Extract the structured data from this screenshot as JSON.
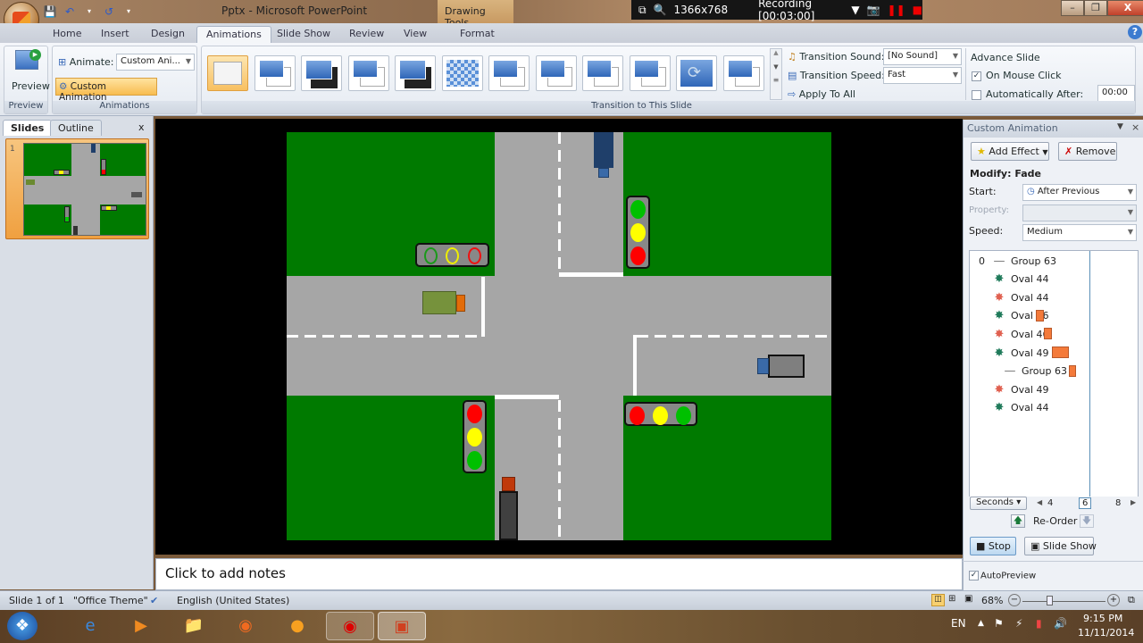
{
  "window": {
    "title": "Pptx - Microsoft PowerPoint",
    "contextual_tab_group": "Drawing Tools",
    "controls": [
      "minimize",
      "restore",
      "close"
    ]
  },
  "recorder": {
    "resolution": "1366x768",
    "status": "Recording [00:03:00]"
  },
  "ribbon_tabs": [
    "Home",
    "Insert",
    "Design",
    "Animations",
    "Slide Show",
    "Review",
    "View",
    "Format"
  ],
  "active_tab": "Animations",
  "ribbon": {
    "preview": {
      "button_label": "Preview",
      "group_label": "Preview"
    },
    "animations": {
      "animate_label": "Animate:",
      "animate_value": "Custom Ani...",
      "custom_animation_label": "Custom Animation",
      "group_label": "Animations"
    },
    "transition": {
      "group_label": "Transition to This Slide",
      "effects": [
        "No Transition",
        "Fade Smoothly",
        "Fade Through Black",
        "Cut",
        "Cut Through Black",
        "Dissolve",
        "Wipe Down",
        "Wipe Left",
        "Wipe Right",
        "Wipe Up",
        "Wheel",
        "Cover Down"
      ],
      "sound_label": "Transition Sound:",
      "sound_value": "[No Sound]",
      "speed_label": "Transition Speed:",
      "speed_value": "Fast",
      "apply_all_label": "Apply To All"
    },
    "advance": {
      "title": "Advance Slide",
      "on_mouse_click_label": "On Mouse Click",
      "on_mouse_click_checked": true,
      "auto_after_label": "Automatically After:",
      "auto_after_checked": false,
      "auto_after_value": "00:00"
    }
  },
  "slides_panel": {
    "tabs": [
      "Slides",
      "Outline"
    ],
    "close": "x",
    "slide_number": "1"
  },
  "notes": {
    "placeholder": "Click to add notes"
  },
  "task_pane": {
    "title": "Custom Animation",
    "add_effect_label": "Add Effect",
    "remove_label": "Remove",
    "modify_label": "Modify: Fade",
    "start_label": "Start:",
    "start_value": "After Previous",
    "property_label": "Property:",
    "property_value": "",
    "speed_label": "Speed:",
    "speed_value": "Medium",
    "items": [
      {
        "index": "0",
        "kind": "group",
        "name": "Group 63"
      },
      {
        "index": "",
        "kind": "entrance",
        "name": "Oval 44"
      },
      {
        "index": "",
        "kind": "exit",
        "name": "Oval 44"
      },
      {
        "index": "",
        "kind": "entrance",
        "name": "Oval 46"
      },
      {
        "index": "",
        "kind": "exit",
        "name": "Oval 46"
      },
      {
        "index": "",
        "kind": "entrance",
        "name": "Oval 49"
      },
      {
        "index": "",
        "kind": "group",
        "name": "Group 63"
      },
      {
        "index": "",
        "kind": "exit",
        "name": "Oval 49"
      },
      {
        "index": "",
        "kind": "entrance",
        "name": "Oval 44"
      }
    ],
    "timeline": {
      "unit_label": "Seconds",
      "ticks": [
        "4",
        "6",
        "8"
      ],
      "bars": [
        {
          "row": 3,
          "start_s": 3.0,
          "end_s": 3.5
        },
        {
          "row": 4,
          "start_s": 3.5,
          "end_s": 4.0
        },
        {
          "row": 5,
          "start_s": 4.0,
          "end_s": 5.0
        },
        {
          "row": 6,
          "start_s": 5.0,
          "end_s": 5.4
        }
      ],
      "playhead_s": 4.2
    },
    "reorder_label": "Re-Order",
    "stop_label": "Stop",
    "slide_show_label": "Slide Show",
    "autopreview_label": "AutoPreview",
    "autopreview_checked": true
  },
  "statusbar": {
    "slide_info": "Slide 1 of 1",
    "theme": "\"Office Theme\"",
    "language": "English (United States)",
    "zoom": "68%"
  },
  "taskbar": {
    "apps": [
      "Start",
      "Internet Explorer",
      "Windows Media Player",
      "Windows Explorer",
      "Firefox",
      "GOM Player",
      "Recorder",
      "PowerPoint"
    ],
    "language": "EN",
    "time": "9:15 PM",
    "date": "11/11/2014"
  },
  "colors": {
    "grass": "#007a00",
    "road": "#a6a6a6",
    "light_red": "#ff0000",
    "light_yellow": "#ffff00",
    "light_green": "#00c000",
    "timeline_bar": "#f47a3a"
  }
}
